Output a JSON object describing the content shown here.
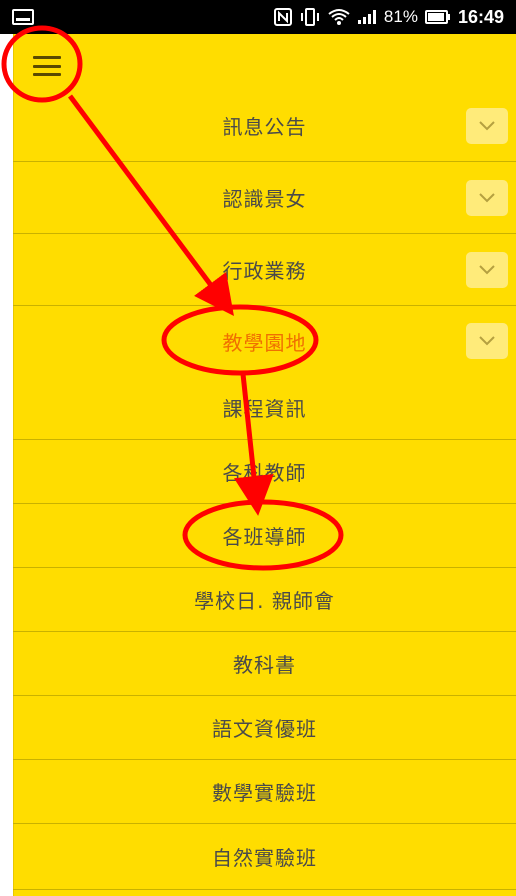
{
  "status_bar": {
    "battery_percent": "81%",
    "time": "16:49",
    "icons": [
      "notification-icon",
      "nfc-icon",
      "vibrate-icon",
      "wifi-icon",
      "signal-icon",
      "battery-icon"
    ]
  },
  "nav": {
    "menu_icon": "hamburger-menu-icon",
    "sections": [
      {
        "label": "訊息公告",
        "expand_icon": "chevron-down-icon"
      },
      {
        "label": "認識景女",
        "expand_icon": "chevron-down-icon"
      },
      {
        "label": "行政業務",
        "expand_icon": "chevron-down-icon"
      },
      {
        "label": "教學園地",
        "expand_icon": "chevron-down-icon",
        "active": true
      }
    ],
    "subitems": [
      {
        "label": "課程資訊"
      },
      {
        "label": "各科教師"
      },
      {
        "label": "各班導師"
      },
      {
        "label": "學校日. 親師會"
      },
      {
        "label": "教科書"
      },
      {
        "label": "語文資優班"
      },
      {
        "label": "數學實驗班"
      },
      {
        "label": "自然實驗班"
      }
    ]
  },
  "colors": {
    "panel": "#ffdd00",
    "active_text": "#f07000",
    "annotation": "#ff0000"
  }
}
